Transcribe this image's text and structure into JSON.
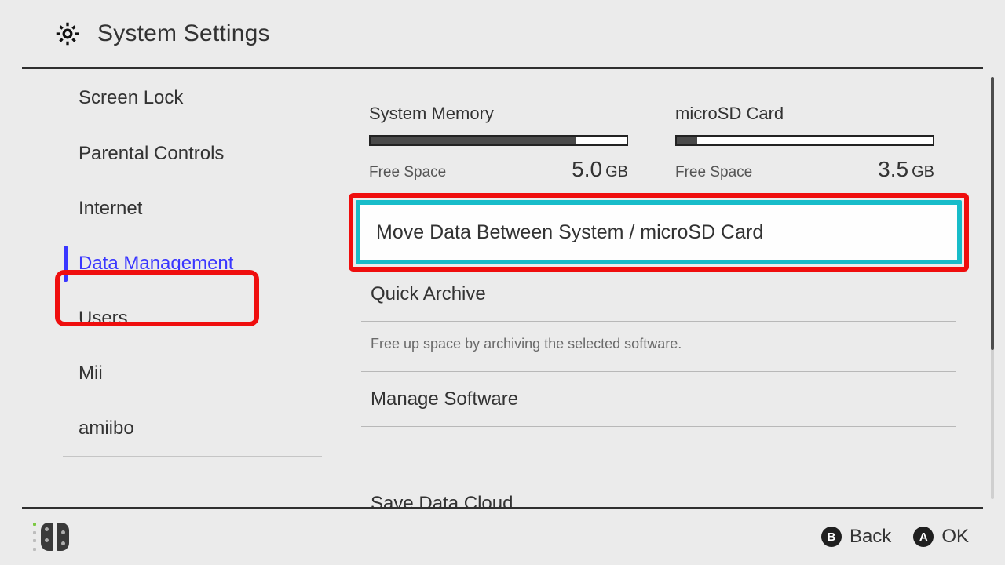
{
  "header": {
    "title": "System Settings"
  },
  "sidebar": {
    "items": [
      {
        "label": "Screen Lock",
        "selected": false,
        "sep": true
      },
      {
        "label": "Parental Controls",
        "selected": false,
        "sep": false
      },
      {
        "label": "Internet",
        "selected": false,
        "sep": false
      },
      {
        "label": "Data Management",
        "selected": true,
        "sep": false
      },
      {
        "label": "Users",
        "selected": false,
        "sep": false
      },
      {
        "label": "Mii",
        "selected": false,
        "sep": false
      },
      {
        "label": "amiibo",
        "selected": false,
        "sep": true
      }
    ]
  },
  "storage": {
    "system": {
      "title": "System Memory",
      "free_label": "Free Space",
      "free_value": "5.0",
      "free_unit": "GB",
      "fill_pct": 80
    },
    "sd": {
      "title": "microSD Card",
      "free_label": "Free Space",
      "free_value": "3.5",
      "free_unit": "GB",
      "fill_pct": 8
    }
  },
  "options": {
    "move": {
      "label": "Move Data Between System / microSD Card"
    },
    "archive": {
      "label": "Quick Archive",
      "desc": "Free up space by archiving the selected software."
    },
    "manage": {
      "label": "Manage Software"
    },
    "cloud": {
      "label": "Save Data Cloud"
    }
  },
  "footer": {
    "back": {
      "glyph": "B",
      "label": "Back"
    },
    "ok": {
      "glyph": "A",
      "label": "OK"
    }
  }
}
